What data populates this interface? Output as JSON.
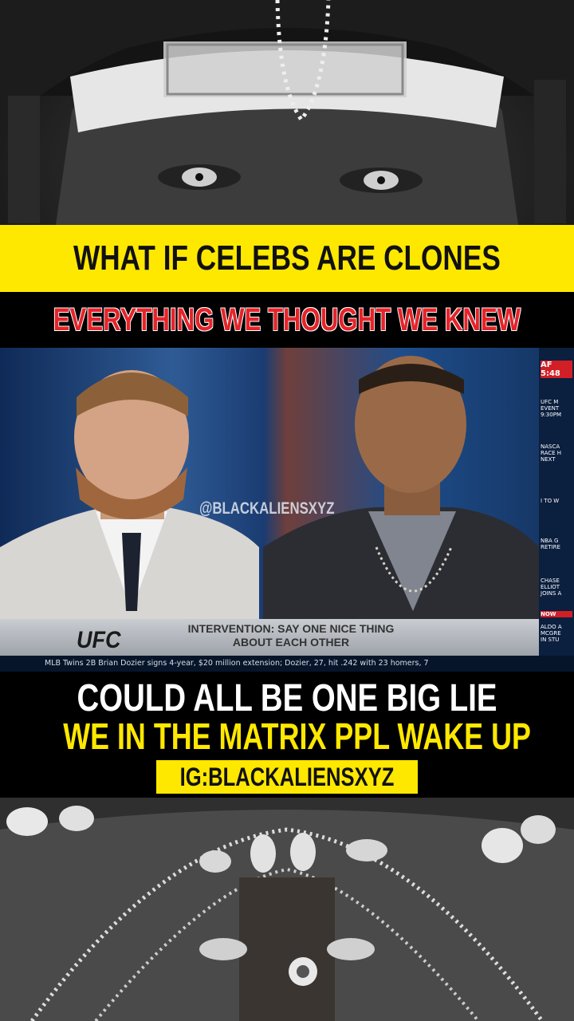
{
  "headline": "WHAT IF  CELEBS ARE CLONES",
  "subheadline": "EVERYTHING WE THOUGHT  WE KNEW",
  "video": {
    "watermark": "@BLACKALIENSXYZ",
    "network_logo": "UFC",
    "lower_third": "INTERVENTION: SAY ONE NICE THING\nABOUT EACH OTHER",
    "lower_third_line1": "INTERVENTION: SAY ONE NICE THING",
    "lower_third_line2": "ABOUT EACH OTHER",
    "ticker": "MLB   Twins 2B Brian Dozier signs 4-year, $20 million extension; Dozier, 27, hit .242 with 23 homers, 7",
    "sidebar": {
      "s1": "AF\n5:48",
      "s2": "UFC M\nEVENT\n9:30PM",
      "s3": "NASCA\nRACE H\nNEXT",
      "s4": "I TO W",
      "s5": "NBA G\nRETIRE",
      "s6": "CHASE\nELLIOT\nJOINS A",
      "s7": "NOW",
      "s8": "ALDO A\nMCGRE\nIN STU"
    }
  },
  "caption_line1": "COULD ALL BE ONE BIG LIE",
  "caption_line2": "WE IN THE MATRIX PPL WAKE UP",
  "ig_handle": "IG:BLACKALIENSXYZ",
  "colors": {
    "yellow": "#ffe800",
    "red": "#e5242a",
    "black": "#000000"
  }
}
